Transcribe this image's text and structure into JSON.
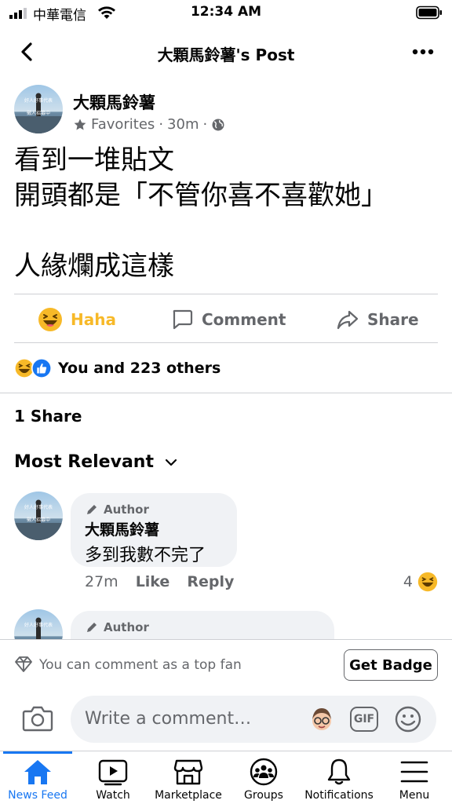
{
  "status_bar": {
    "carrier": "中華電信",
    "time": "12:34 AM"
  },
  "nav": {
    "title": "大顆馬鈴薯's Post"
  },
  "post": {
    "author": "大顆馬鈴薯",
    "audience": "Favorites",
    "time": "30m",
    "separator": "·",
    "avatar_text": [
      "好人好事代表",
      "徵人招募中"
    ],
    "body_lines": [
      "看到一堆貼文",
      "開頭都是「不管你喜不喜歡她」",
      "",
      "人緣爛成這樣"
    ]
  },
  "actions": {
    "reaction_label": "Haha",
    "comment_label": "Comment",
    "share_label": "Share"
  },
  "reactions_summary": "You and 223 others",
  "shares_count": "1 Share",
  "sort_label": "Most Relevant",
  "comments": [
    {
      "badge": "Author",
      "name": "大顆馬鈴薯",
      "text": "多到我數不完了",
      "time": "27m",
      "like_label": "Like",
      "reply_label": "Reply",
      "reaction_count": "4"
    },
    {
      "badge": "Author"
    }
  ],
  "top_fan": {
    "message": "You can comment as a top fan",
    "button": "Get Badge"
  },
  "composer": {
    "placeholder": "Write a comment…",
    "gif_label": "GIF"
  },
  "tabs": [
    {
      "label": "News Feed",
      "icon": "home-icon"
    },
    {
      "label": "Watch",
      "icon": "watch-icon"
    },
    {
      "label": "Marketplace",
      "icon": "marketplace-icon"
    },
    {
      "label": "Groups",
      "icon": "groups-icon"
    },
    {
      "label": "Notifications",
      "icon": "bell-icon"
    },
    {
      "label": "Menu",
      "icon": "menu-icon"
    }
  ],
  "colors": {
    "accent": "#1877f2",
    "haha": "#f7b928",
    "secondary_text": "#65676b",
    "bubble": "#f0f2f5"
  }
}
